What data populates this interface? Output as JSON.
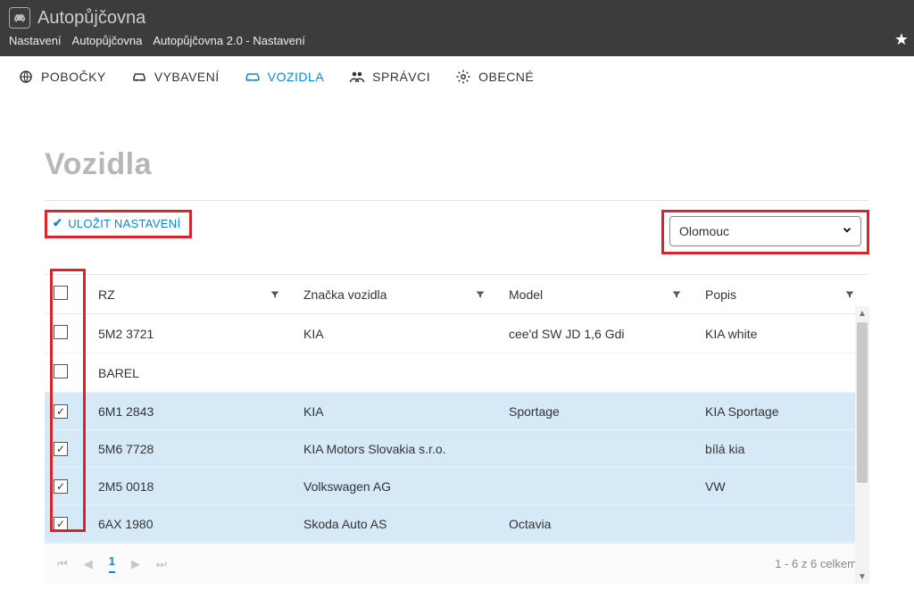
{
  "app": {
    "title": "Autopůjčovna"
  },
  "breadcrumbs": [
    "Nastavení",
    "Autopůjčovna",
    "Autopůjčovna 2.0 - Nastavení"
  ],
  "nav": {
    "items": [
      {
        "label": "POBOČKY"
      },
      {
        "label": "VYBAVENÍ"
      },
      {
        "label": "VOZIDLA",
        "active": true
      },
      {
        "label": "SPRÁVCI"
      },
      {
        "label": "OBECNÉ"
      }
    ]
  },
  "page": {
    "title": "Vozidla"
  },
  "toolbar": {
    "save_label": "ULOŽIT NASTAVENÍ",
    "dropdown_value": "Olomouc"
  },
  "table": {
    "columns": [
      "RZ",
      "Značka vozidla",
      "Model",
      "Popis"
    ],
    "rows": [
      {
        "checked": false,
        "rz": "5M2 3721",
        "make": "KIA",
        "model": "cee'd SW JD 1,6 Gdi",
        "desc": "KIA white"
      },
      {
        "checked": false,
        "rz": "BAREL",
        "make": "",
        "model": "",
        "desc": ""
      },
      {
        "checked": true,
        "rz": "6M1 2843",
        "make": "KIA",
        "model": "Sportage",
        "desc": "KIA Sportage"
      },
      {
        "checked": true,
        "rz": "5M6 7728",
        "make": "KIA Motors Slovakia s.r.o.",
        "model": "",
        "desc": "bílá kia"
      },
      {
        "checked": true,
        "rz": "2M5 0018",
        "make": "Volkswagen AG",
        "model": "",
        "desc": "VW"
      },
      {
        "checked": true,
        "rz": "6AX 1980",
        "make": "Skoda Auto AS",
        "model": "Octavia",
        "desc": ""
      }
    ]
  },
  "pager": {
    "current": "1",
    "summary": "1 - 6 z 6 celkem"
  }
}
